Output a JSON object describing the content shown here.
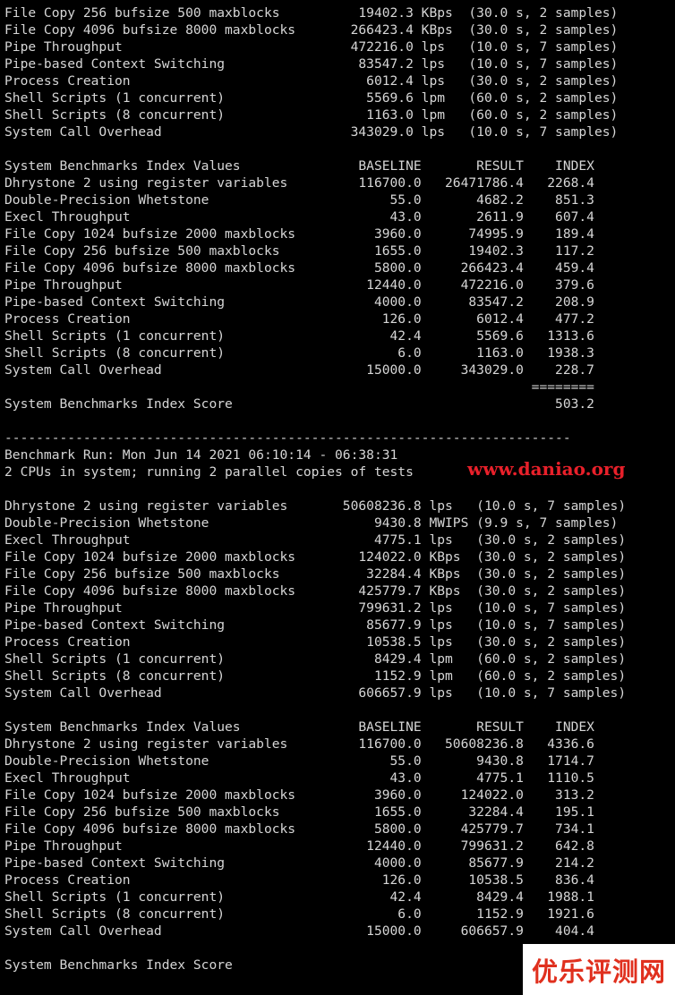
{
  "terminal": {
    "lines": [
      "File Copy 256 bufsize 500 maxblocks          19402.3 KBps  (30.0 s, 2 samples)",
      "File Copy 4096 bufsize 8000 maxblocks       266423.4 KBps  (30.0 s, 2 samples)",
      "Pipe Throughput                             472216.0 lps   (10.0 s, 7 samples)",
      "Pipe-based Context Switching                 83547.2 lps   (10.0 s, 7 samples)",
      "Process Creation                              6012.4 lps   (30.0 s, 2 samples)",
      "Shell Scripts (1 concurrent)                  5569.6 lpm   (60.0 s, 2 samples)",
      "Shell Scripts (8 concurrent)                  1163.0 lpm   (60.0 s, 2 samples)",
      "System Call Overhead                        343029.0 lps   (10.0 s, 7 samples)",
      "",
      "System Benchmarks Index Values               BASELINE       RESULT    INDEX",
      "Dhrystone 2 using register variables         116700.0   26471786.4   2268.4",
      "Double-Precision Whetstone                       55.0       4682.2    851.3",
      "Execl Throughput                                 43.0       2611.9    607.4",
      "File Copy 1024 bufsize 2000 maxblocks          3960.0      74995.9    189.4",
      "File Copy 256 bufsize 500 maxblocks            1655.0      19402.3    117.2",
      "File Copy 4096 bufsize 8000 maxblocks          5800.0     266423.4    459.4",
      "Pipe Throughput                               12440.0     472216.0    379.6",
      "Pipe-based Context Switching                   4000.0      83547.2    208.9",
      "Process Creation                                126.0       6012.4    477.2",
      "Shell Scripts (1 concurrent)                     42.4       5569.6   1313.6",
      "Shell Scripts (8 concurrent)                      6.0       1163.0   1938.3",
      "System Call Overhead                          15000.0     343029.0    228.7",
      "                                                                   ========",
      "System Benchmarks Index Score                                         503.2",
      "",
      "------------------------------------------------------------------------",
      "Benchmark Run: Mon Jun 14 2021 06:10:14 - 06:38:31",
      "2 CPUs in system; running 2 parallel copies of tests",
      "",
      "Dhrystone 2 using register variables       50608236.8 lps   (10.0 s, 7 samples)",
      "Double-Precision Whetstone                     9430.8 MWIPS (9.9 s, 7 samples)",
      "Execl Throughput                               4775.1 lps   (30.0 s, 2 samples)",
      "File Copy 1024 bufsize 2000 maxblocks        124022.0 KBps  (30.0 s, 2 samples)",
      "File Copy 256 bufsize 500 maxblocks           32284.4 KBps  (30.0 s, 2 samples)",
      "File Copy 4096 bufsize 8000 maxblocks        425779.7 KBps  (30.0 s, 2 samples)",
      "Pipe Throughput                              799631.2 lps   (10.0 s, 7 samples)",
      "Pipe-based Context Switching                  85677.9 lps   (10.0 s, 7 samples)",
      "Process Creation                              10538.5 lps   (30.0 s, 2 samples)",
      "Shell Scripts (1 concurrent)                   8429.4 lpm   (60.0 s, 2 samples)",
      "Shell Scripts (8 concurrent)                   1152.9 lpm   (60.0 s, 2 samples)",
      "System Call Overhead                         606657.9 lps   (10.0 s, 7 samples)",
      "",
      "System Benchmarks Index Values               BASELINE       RESULT    INDEX",
      "Dhrystone 2 using register variables         116700.0   50608236.8   4336.6",
      "Double-Precision Whetstone                       55.0       9430.8   1714.7",
      "Execl Throughput                                 43.0       4775.1   1110.5",
      "File Copy 1024 bufsize 2000 maxblocks          3960.0     124022.0    313.2",
      "File Copy 256 bufsize 500 maxblocks            1655.0      32284.4    195.1",
      "File Copy 4096 bufsize 8000 maxblocks          5800.0     425779.7    734.1",
      "Pipe Throughput                               12440.0     799631.2    642.8",
      "Pipe-based Context Switching                   4000.0      85677.9    214.2",
      "Process Creation                                126.0      10538.5    836.4",
      "Shell Scripts (1 concurrent)                     42.4       8429.4   1988.1",
      "Shell Scripts (8 concurrent)                      6.0       1152.9   1921.6",
      "System Call Overhead                          15000.0     606657.9    404.4",
      "",
      "System Benchmarks Index Score"
    ]
  },
  "watermarks": {
    "site": "www.daniao.org",
    "logo": "优乐评测网"
  },
  "colors": {
    "background": "#000000",
    "text": "#d6d6d6",
    "watermark_red": "#e8202a"
  }
}
